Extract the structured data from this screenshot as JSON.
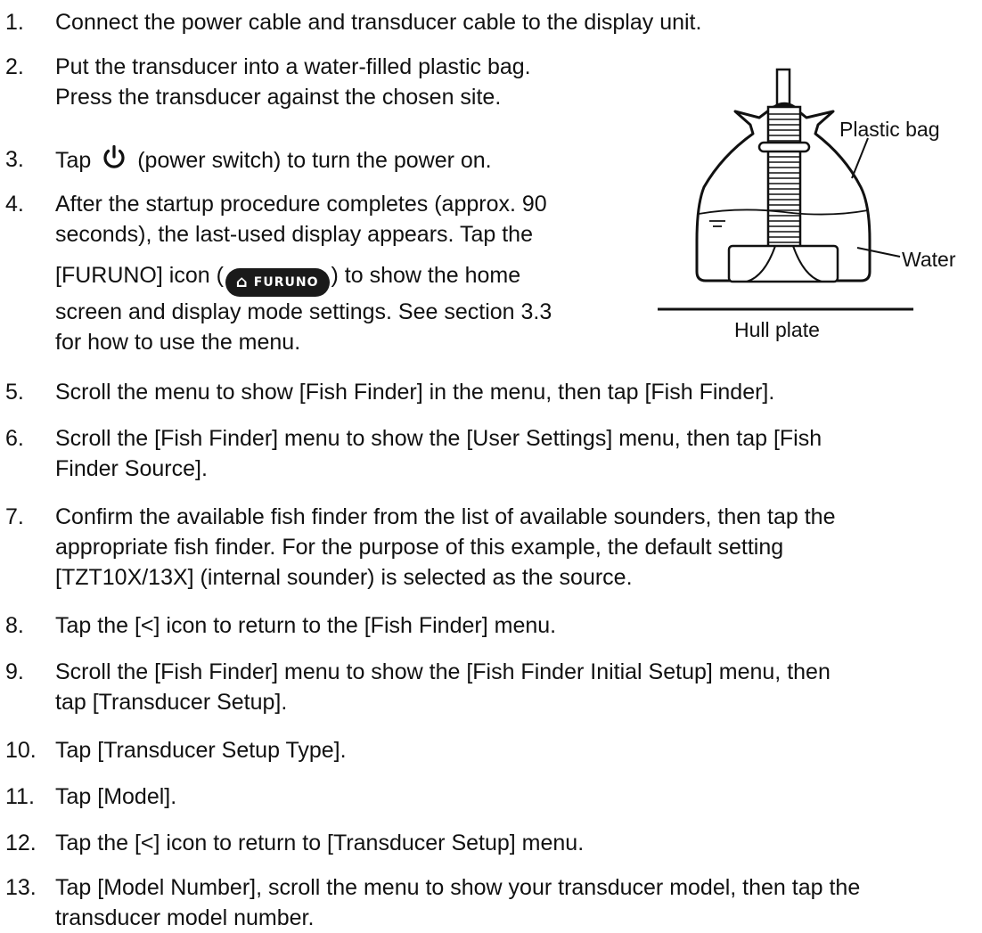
{
  "steps": [
    {
      "num": "1.",
      "lines": [
        "Connect the power cable and transducer cable to the display unit."
      ]
    },
    {
      "num": "2.",
      "lines": [
        "Put the transducer into a water-filled plastic bag.",
        "Press the transducer against the chosen site."
      ]
    },
    {
      "num": "3.",
      "before": "Tap",
      "after": "(power switch) to turn the power on.",
      "icon": "power-icon"
    },
    {
      "num": "4.",
      "lines": [
        "After the startup procedure completes (approx. 90",
        "seconds), the last-used display appears. Tap the"
      ],
      "line3_before": "[FURUNO] icon (",
      "line3_after": ") to show the home",
      "lines_after": [
        "screen and display mode settings. See section 3.3",
        "for how to use the menu."
      ],
      "badge": {
        "text": "FURUNO",
        "icon": "home-icon"
      }
    },
    {
      "num": "5.",
      "lines": [
        "Scroll the menu to show [Fish Finder] in the menu, then tap [Fish Finder]."
      ]
    },
    {
      "num": "6.",
      "lines": [
        "Scroll the [Fish Finder] menu to show the [User Settings] menu, then tap [Fish",
        "Finder Source]."
      ]
    },
    {
      "num": "7.",
      "lines": [
        "Confirm the available fish finder from the list of available sounders, then tap the",
        "appropriate fish finder. For the purpose of this example, the default setting",
        "[TZT10X/13X] (internal sounder) is selected as the source."
      ]
    },
    {
      "num": "8.",
      "lines": [
        "Tap the [<] icon to return to the [Fish Finder] menu."
      ]
    },
    {
      "num": "9.",
      "lines": [
        "Scroll the [Fish Finder] menu to show the [Fish Finder Initial Setup] menu, then",
        "tap [Transducer Setup]."
      ]
    },
    {
      "num": "10.",
      "lines": [
        "Tap [Transducer Setup Type]."
      ]
    },
    {
      "num": "11.",
      "lines": [
        "Tap [Model]."
      ]
    },
    {
      "num": "12.",
      "lines": [
        "Tap the [<] icon to return to [Transducer Setup] menu."
      ]
    },
    {
      "num": "13.",
      "lines": [
        "Tap [Model Number], scroll the menu to show your transducer model, then tap the",
        "transducer model number."
      ]
    }
  ],
  "figure": {
    "label_bag": "Plastic bag",
    "label_water": "Water",
    "label_hull": "Hull plate",
    "stroke_color": "#111111"
  }
}
